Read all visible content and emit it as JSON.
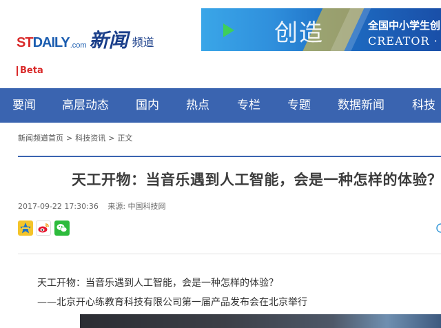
{
  "header": {
    "logo": {
      "st": "ST",
      "daily": "DAILY",
      "com": ".com",
      "xinwen": "新闻",
      "pindao": "频道"
    },
    "beta": "Beta",
    "banner": {
      "chuangzao": "创造",
      "line1": "全国中小学生创",
      "line2": "CREATOR · M"
    }
  },
  "nav": {
    "items": [
      "要闻",
      "高层动态",
      "国内",
      "热点",
      "专栏",
      "专题",
      "数据新闻",
      "科技"
    ]
  },
  "breadcrumb": [
    "新闻频道首页",
    "科技资讯",
    "正文"
  ],
  "breadcrumb_sep": ">",
  "article": {
    "title": "天工开物：当音乐遇到人工智能，会是一种怎样的体验？",
    "date": "2017-09-22 17:30:36",
    "source": "来源: 中国科技网",
    "para1": "天工开物：当音乐遇到人工智能，会是一种怎样的体验？",
    "para2": "——北京开心练教育科技有限公司第一届产品发布会在北京举行"
  },
  "share": {
    "icons": [
      "qzone-icon",
      "weibo-icon",
      "wechat-icon"
    ]
  },
  "colors": {
    "nav_bg": "#3a64b0",
    "accent_red": "#d92a2a",
    "logo_blue": "#1b5db0"
  }
}
